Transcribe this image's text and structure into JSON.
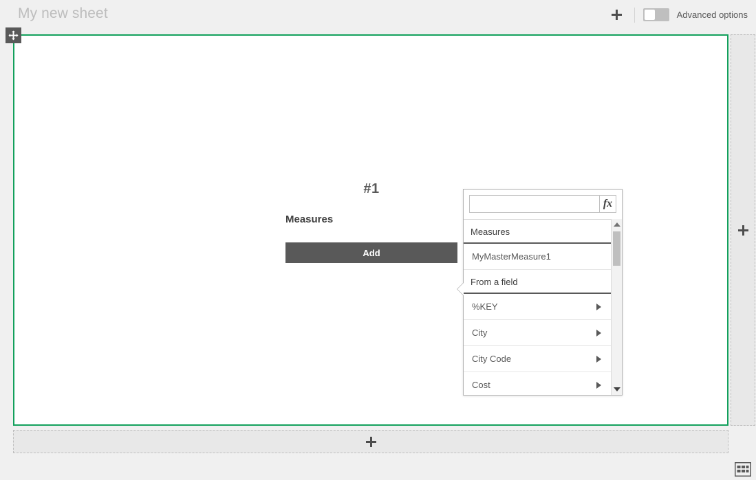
{
  "topbar": {
    "sheet_title": "My new sheet",
    "add_sheet_icon": "plus-icon",
    "advanced_options_label": "Advanced options",
    "advanced_options_state": "off"
  },
  "sheet": {
    "move_handle_icon": "move-icon",
    "border_color": "#12a05c"
  },
  "measures_panel": {
    "index_label": "#1",
    "section_label": "Measures",
    "add_button_label": "Add",
    "add_button_color": "#595959"
  },
  "popover": {
    "search_value": "",
    "search_placeholder": "",
    "expression_button_label": "fx",
    "expression_button_icon": "fx-icon",
    "sections": [
      {
        "header": "Measures",
        "items": [
          {
            "label": "MyMasterMeasure1",
            "has_arrow": false
          }
        ]
      },
      {
        "header": "From a field",
        "items": [
          {
            "label": "%KEY",
            "has_arrow": true
          },
          {
            "label": "City",
            "has_arrow": true
          },
          {
            "label": "City Code",
            "has_arrow": true
          },
          {
            "label": "Cost",
            "has_arrow": true
          }
        ]
      }
    ],
    "scrollbar": {
      "up_icon": "triangle-up-icon",
      "down_icon": "triangle-down-icon"
    }
  },
  "dropzones": {
    "right_icon": "plus-icon",
    "bottom_icon": "plus-icon"
  },
  "footer": {
    "grid_icon": "grid-icon"
  }
}
